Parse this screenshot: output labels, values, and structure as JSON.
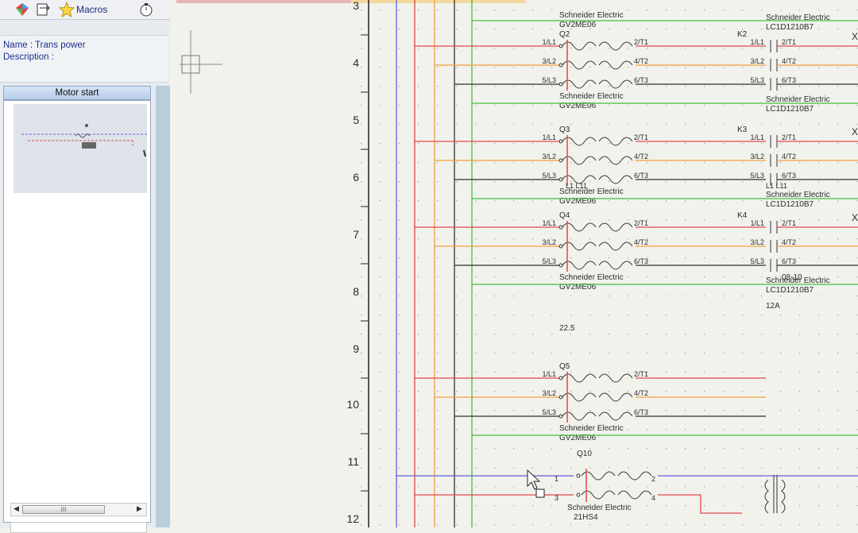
{
  "tabs": {
    "macros_label": "Macros"
  },
  "macro_info": {
    "name": "Name : Trans power",
    "description": "Description :"
  },
  "macro_panel": {
    "title": "Motor start",
    "scroll_thumb_grip": "III"
  },
  "drawing": {
    "row_numbers": [
      "3",
      "4",
      "5",
      "6",
      "7",
      "8",
      "9",
      "10",
      "11",
      "12"
    ],
    "colors": {
      "blue": "#6060e0",
      "red": "#e04848",
      "orange": "#f0a040",
      "green": "#40c040",
      "dark": "#303030"
    },
    "ref_22_5": "22.5",
    "breakers": [
      {
        "tag": "Q2",
        "maker": "Schneider Electric",
        "part": "GV2ME06",
        "poles": [
          "1/L1",
          "3/L2",
          "5/L3"
        ],
        "outs": [
          "2/T1",
          "4/T2",
          "6/T3"
        ]
      },
      {
        "tag": "Q3",
        "maker": "Schneider Electric",
        "part": "GV2ME06",
        "poles": [
          "1/L1",
          "3/L2",
          "5/L3"
        ],
        "outs": [
          "2/T1",
          "4/T2",
          "6/T3"
        ]
      },
      {
        "tag": "Q4",
        "maker": "Schneider Electric",
        "part": "GV2ME06",
        "poles": [
          "1/L1",
          "3/L2",
          "5/L3"
        ],
        "outs": [
          "2/T1",
          "4/T2",
          "6/T3"
        ]
      },
      {
        "tag": "Q5",
        "maker": "Schneider Electric",
        "part": "GV2ME06",
        "poles": [
          "1/L1",
          "3/L2",
          "5/L3"
        ],
        "outs": [
          "2/T1",
          "4/T2",
          "6/T3"
        ]
      }
    ],
    "contactors": [
      {
        "tag": "K2",
        "maker": "Schneider Electric",
        "part": "LC1D1210B7",
        "poles": [
          "1/L1",
          "3/L2",
          "5/L3"
        ],
        "outs": [
          "2/T1",
          "4/T2",
          "6/T3"
        ]
      },
      {
        "tag": "K3",
        "maker": "Schneider Electric",
        "part": "LC1D1210B7",
        "poles": [
          "1/L1",
          "3/L2",
          "5/L3"
        ],
        "outs": [
          "2/T1",
          "4/T2",
          "6/T3"
        ]
      },
      {
        "tag": "K4",
        "maker": "Schneider Electric",
        "part": "LC1D1210B7",
        "poles": [
          "1/L1",
          "3/L2",
          "5/L3"
        ],
        "outs": [
          "2/T1",
          "4/T2",
          "6/T3"
        ],
        "extra1": "08-10",
        "extra2": "12A"
      }
    ],
    "top_maker_left": "Schneider Electric",
    "top_part_left": "GV2ME06",
    "top_maker_right": "Schneider Electric",
    "top_part_right": "LC1D1210B7",
    "l1_label": "L1 L11",
    "q10": {
      "tag": "Q10",
      "maker": "Schneider Electric",
      "part": "21HS4",
      "pins": [
        "1",
        "2",
        "3",
        "4"
      ]
    }
  }
}
